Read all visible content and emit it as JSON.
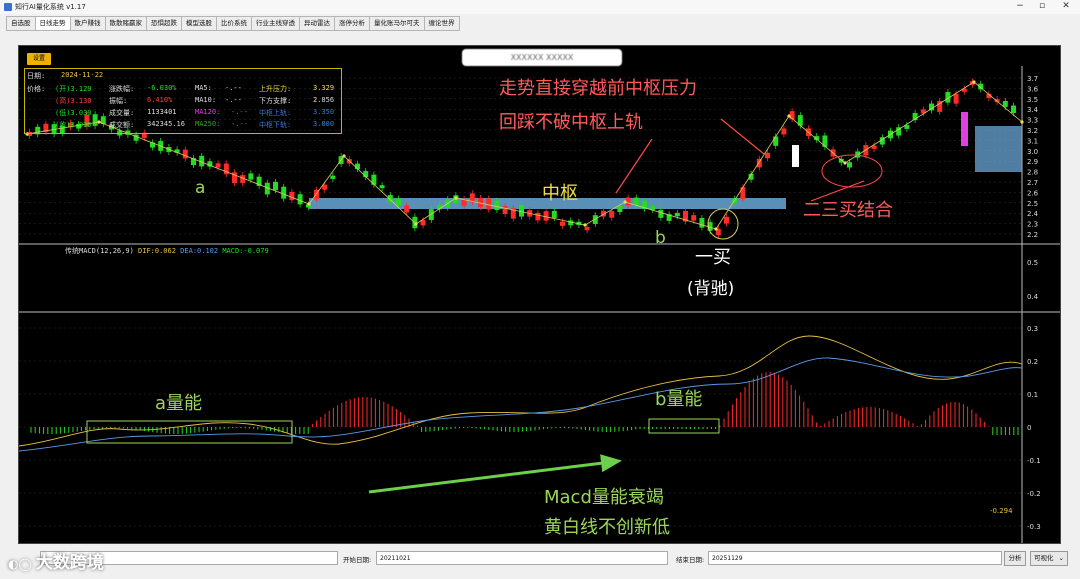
{
  "window": {
    "title": "知行AI量化系统 v1.17"
  },
  "tabs": [
    "自选股",
    "日线走势",
    "散户赚钱",
    "散散赌赢家",
    "恐惧超跌",
    "模型选股",
    "比价系统",
    "行业主线穿透",
    "异动雷达",
    "涨停分析",
    "量化账马尔可夫",
    "缠论世界"
  ],
  "settings_label": "设置",
  "stock_name": "XXXXXX XXXXX",
  "info": {
    "date_label": "日期:",
    "date": "2024-11-22",
    "price_label": "价格:",
    "open": "(开)3.120",
    "high": "(高)3.130",
    "low": "(低)3.030",
    "close": "(收)3.030",
    "chg_label": "涨跌幅:",
    "chg": "-6.030%",
    "amp_label": "振幅:",
    "amp": "6.410%",
    "vol_label": "成交量:",
    "vol": "1133401",
    "amt_label": "成交额:",
    "amt": "342345.16",
    "ma5_label": "MA5:",
    "ma5": "-.--",
    "ma10_label": "MA10:",
    "ma10": "-.--",
    "ma120_label": "MA120:",
    "ma120": "-.--",
    "ma250_label": "MA250:",
    "ma250": "-.--",
    "up_label": "上升压力:",
    "up": "3.329",
    "down_label": "下方支撑:",
    "down": "2.856",
    "zs_up_label": "中枢上轨:",
    "zs_up": "3.350",
    "zs_down_label": "中枢下轨:",
    "zs_down": "3.800"
  },
  "price_axis": [
    "3.7",
    "3.6",
    "3.5",
    "3.4",
    "3.3",
    "3.2",
    "3.1",
    "3.0",
    "2.9",
    "2.8",
    "2.7",
    "2.6",
    "2.5",
    "2.4",
    "2.3",
    "2.2"
  ],
  "mid_axis": [
    "0.5",
    "0.4"
  ],
  "macd_axis": [
    "0.3",
    "0.2",
    "0.1",
    "0",
    "-0.1",
    "-0.2",
    "-0.3"
  ],
  "macd_header": {
    "name": "传统MACD(12,26,9)",
    "dif": "DIF:0.062",
    "dea": "DEA:0.102",
    "macd": "MACD:-0.079"
  },
  "macd_value": "-0.294",
  "annotations": {
    "title1": "走势直接穿越前中枢压力",
    "title2": "回踩不破中枢上轨",
    "a": "a",
    "b": "b",
    "zhongshu": "中枢",
    "buy1": "一买",
    "beichi": "(背驰)",
    "buy23": "二三买结合",
    "a_vol": "a量能",
    "b_vol": "b量能",
    "macd1": "Macd量能衰竭",
    "macd2": "黄白线不创新低"
  },
  "bottom": {
    "start_label": "开始日期:",
    "start": "20211021",
    "end_label": "结束日期:",
    "end": "20251129",
    "analyze": "分析",
    "mode": "可视化"
  },
  "watermark": "大数跨境",
  "colors": {
    "up": "#ff2a2a",
    "down": "#22dd22",
    "zone": "#6aa8d8",
    "annotation": "#ff5b5b",
    "label": "#9bd65b"
  }
}
